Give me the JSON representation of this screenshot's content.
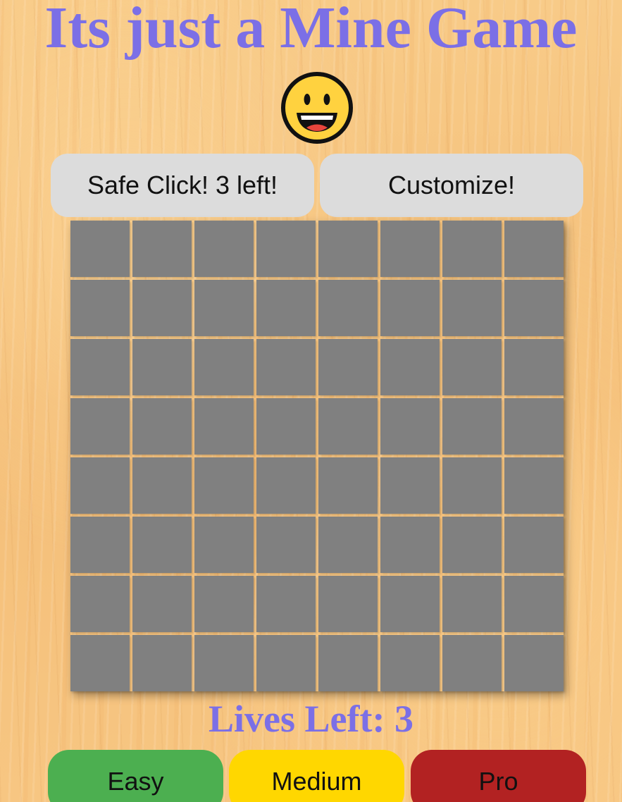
{
  "title": "Its just a Mine Game",
  "face": {
    "icon": "grinning-face-icon"
  },
  "buttons": {
    "safe_click": "Safe Click! 3 left!",
    "customize": "Customize!"
  },
  "board": {
    "rows": 8,
    "cols": 8,
    "cell_state": "unrevealed",
    "cell_color": "#808080"
  },
  "lives": "Lives Left: 3",
  "difficulty": [
    {
      "label": "Easy",
      "color": "#4caf50"
    },
    {
      "label": "Medium",
      "color": "#ffd700"
    },
    {
      "label": "Pro",
      "color": "#b22222"
    }
  ],
  "colors": {
    "title": "#7b6fe6",
    "button_bg": "#dcdcdc",
    "face": "#ffd23f"
  }
}
